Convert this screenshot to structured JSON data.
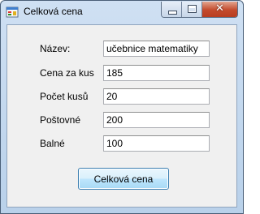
{
  "window": {
    "title": "Celková cena",
    "icon": "app-window-icon",
    "controls": {
      "minimize": "minimize-icon",
      "maximize": "maximize-icon",
      "close": "close-icon",
      "close_glyph": "✕"
    }
  },
  "form": {
    "fields": [
      {
        "label": "Název:",
        "value": "učebnice matematiky"
      },
      {
        "label": "Cena za kus",
        "value": "185"
      },
      {
        "label": "Počet kusů",
        "value": "20"
      },
      {
        "label": "Poštovné",
        "value": "200"
      },
      {
        "label": "Balné",
        "value": "100"
      }
    ],
    "button_label": "Celková cena"
  },
  "colors": {
    "close_button": "#c34a2c",
    "button_border": "#3c7fb1",
    "client_background": "#f0f0f0"
  }
}
